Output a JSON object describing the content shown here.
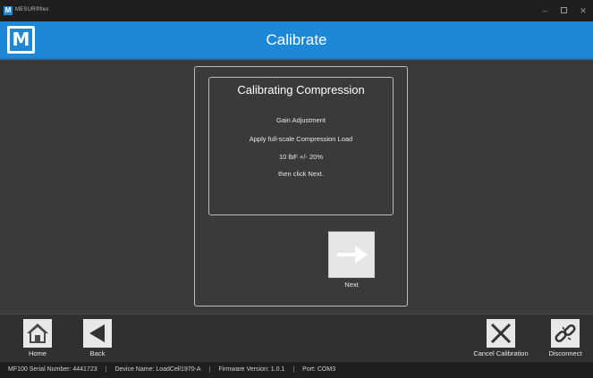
{
  "window": {
    "app_name": "MESUR®flex",
    "logo_letter": "M",
    "controls": [
      "minimize",
      "maximize",
      "close"
    ]
  },
  "header": {
    "logo_letter": "M",
    "title": "Calibrate"
  },
  "panel": {
    "heading": "Calibrating Compression",
    "lines": [
      "Gain Adjustment",
      "Apply full-scale Compression Load",
      "10 lbF  +/- 20%",
      "then click Next."
    ]
  },
  "next_button": {
    "label": "Next",
    "icon": "arrow-right-icon"
  },
  "footer": {
    "home_label": "Home",
    "back_label": "Back",
    "cancel_label": "Cancel Calibration",
    "disconnect_label": "Disconnect"
  },
  "status": {
    "serial": "MF100 Serial Number: 4441723",
    "device": "Device Name: LoadCell1970-A",
    "firmware": "Firmware Version: 1.0.1",
    "port": "Port: COM3",
    "separator": "|"
  },
  "colors": {
    "accent": "#1e88d8",
    "background": "#3a3a3a",
    "button": "#e8e8e8"
  }
}
